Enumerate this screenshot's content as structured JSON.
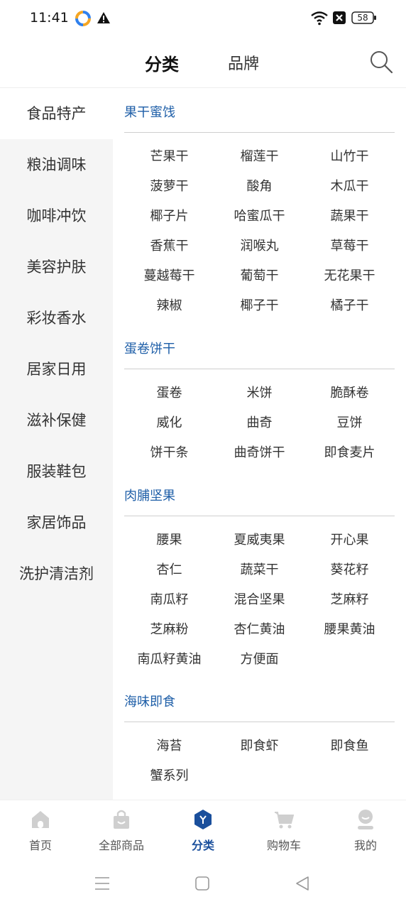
{
  "status_bar": {
    "time": "11:41",
    "battery": "58"
  },
  "header": {
    "tabs": [
      {
        "label": "分类"
      },
      {
        "label": "品牌"
      }
    ]
  },
  "sidebar": {
    "items": [
      {
        "label": "食品特产"
      },
      {
        "label": "粮油调味"
      },
      {
        "label": "咖啡冲饮"
      },
      {
        "label": "美容护肤"
      },
      {
        "label": "彩妆香水"
      },
      {
        "label": "居家日用"
      },
      {
        "label": "滋补保健"
      },
      {
        "label": "服装鞋包"
      },
      {
        "label": "家居饰品"
      },
      {
        "label": "洗护清洁剂"
      }
    ]
  },
  "sections": [
    {
      "title": "果干蜜饯",
      "items": [
        "芒果干",
        "榴莲干",
        "山竹干",
        "菠萝干",
        "酸角",
        "木瓜干",
        "椰子片",
        "哈蜜瓜干",
        "蔬果干",
        "香蕉干",
        "润喉丸",
        "草莓干",
        "蔓越莓干",
        "葡萄干",
        "无花果干",
        "辣椒",
        "椰子干",
        "橘子干"
      ]
    },
    {
      "title": "蛋卷饼干",
      "items": [
        "蛋卷",
        "米饼",
        "脆酥卷",
        "威化",
        "曲奇",
        "豆饼",
        "饼干条",
        "曲奇饼干",
        "即食麦片"
      ]
    },
    {
      "title": "肉脯坚果",
      "items": [
        "腰果",
        "夏威夷果",
        "开心果",
        "杏仁",
        "蔬菜干",
        "葵花籽",
        "南瓜籽",
        "混合坚果",
        "芝麻籽",
        "芝麻粉",
        "杏仁黄油",
        "腰果黄油",
        "南瓜籽黄油",
        "方便面"
      ]
    },
    {
      "title": "海味即食",
      "items": [
        "海苔",
        "即食虾",
        "即食鱼",
        "蟹系列"
      ]
    }
  ],
  "bottom_nav": {
    "items": [
      {
        "label": "首页"
      },
      {
        "label": "全部商品"
      },
      {
        "label": "分类"
      },
      {
        "label": "购物车"
      },
      {
        "label": "我的"
      }
    ]
  },
  "colors": {
    "accent": "#1a4f9c",
    "section_title": "#1f5fa8",
    "sidebar_bg": "#f5f5f5"
  }
}
